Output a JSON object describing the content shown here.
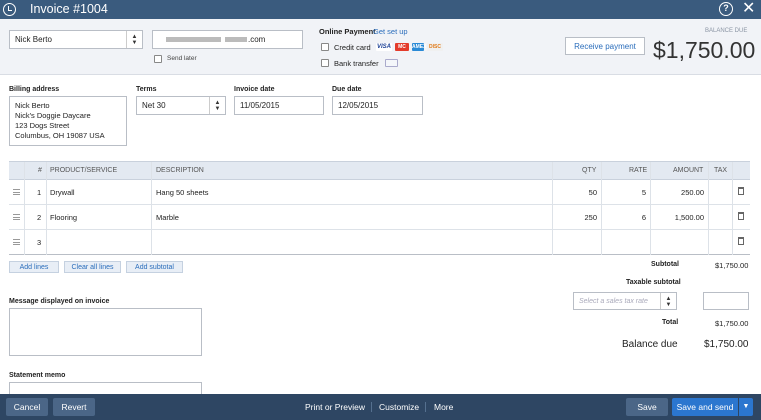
{
  "header": {
    "title": "Invoice #1004"
  },
  "customer": {
    "name": "Nick Berto",
    "email_suffix": ".com",
    "send_later": "Send later"
  },
  "online_payment": {
    "title": "Online Payment",
    "setup": "Get set up",
    "credit_card": "Credit card",
    "bank_transfer": "Bank transfer",
    "cards": [
      "VISA",
      "MC",
      "AMEX",
      "DISC"
    ]
  },
  "receive_payment": "Receive payment",
  "balance": {
    "label": "BALANCE DUE",
    "amount": "$1,750.00"
  },
  "billing": {
    "label": "Billing address",
    "lines": [
      "Nick Berto",
      "Nick's Doggie Daycare",
      "123 Dogs Street",
      "Columbus, OH  19087 USA"
    ]
  },
  "terms": {
    "label": "Terms",
    "value": "Net 30"
  },
  "invoice_date": {
    "label": "Invoice date",
    "value": "11/05/2015"
  },
  "due_date": {
    "label": "Due date",
    "value": "12/05/2015"
  },
  "table": {
    "headers": {
      "num": "#",
      "product": "PRODUCT/SERVICE",
      "description": "DESCRIPTION",
      "qty": "QTY",
      "rate": "RATE",
      "amount": "AMOUNT",
      "tax": "TAX"
    },
    "rows": [
      {
        "num": "1",
        "product": "Drywall",
        "description": "Hang 50 sheets",
        "qty": "50",
        "rate": "5",
        "amount": "250.00"
      },
      {
        "num": "2",
        "product": "Flooring",
        "description": "Marble",
        "qty": "250",
        "rate": "6",
        "amount": "1,500.00"
      },
      {
        "num": "3",
        "product": "",
        "description": "",
        "qty": "",
        "rate": "",
        "amount": ""
      }
    ]
  },
  "line_buttons": {
    "add_lines": "Add lines",
    "clear_all": "Clear all lines",
    "add_subtotal": "Add subtotal"
  },
  "totals": {
    "subtotal_label": "Subtotal",
    "subtotal": "$1,750.00",
    "taxable_label": "Taxable subtotal",
    "tax_placeholder": "Select a sales tax rate",
    "total_label": "Total",
    "total": "$1,750.00",
    "balance_label": "Balance due",
    "balance": "$1,750.00"
  },
  "message_label": "Message displayed on invoice",
  "memo_label": "Statement memo",
  "footer": {
    "cancel": "Cancel",
    "revert": "Revert",
    "print": "Print or Preview",
    "customize": "Customize",
    "more": "More",
    "save": "Save",
    "save_send": "Save and send"
  }
}
